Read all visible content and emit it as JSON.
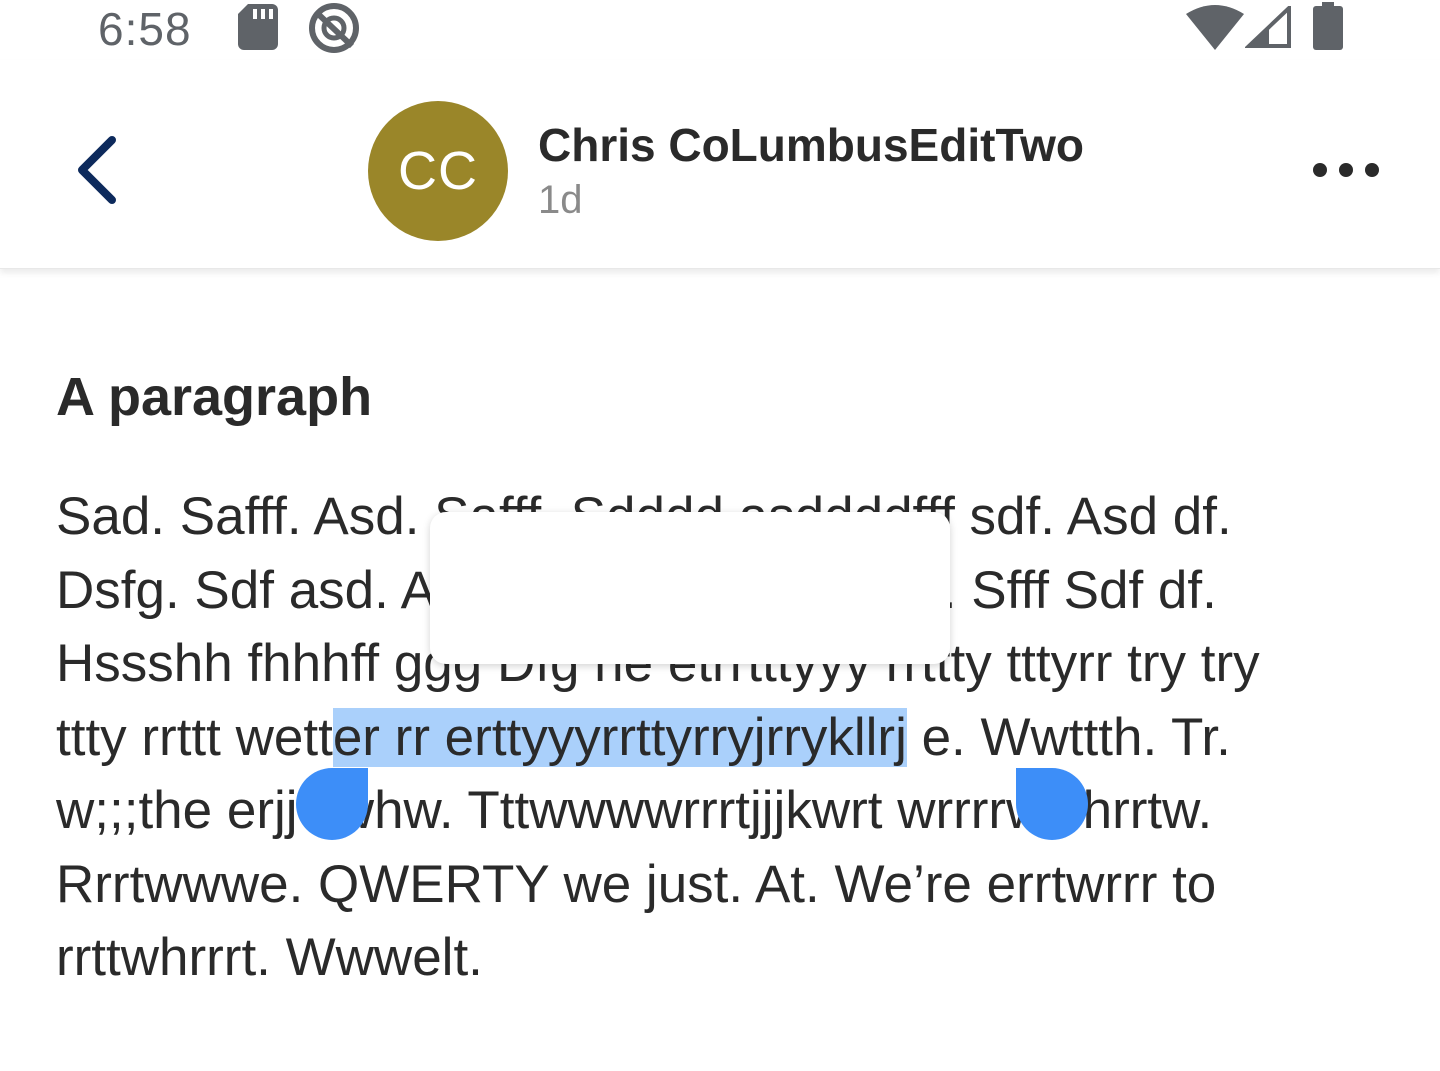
{
  "status_bar": {
    "time": "6:58",
    "icons": [
      "sd-card-icon",
      "do-not-disturb-icon",
      "wifi-icon",
      "signal-icon",
      "battery-icon"
    ]
  },
  "header": {
    "back_icon": "chevron-left-icon",
    "avatar_initials": "CC",
    "avatar_color": "#9a8629",
    "sender_name": "Chris CoLumbusEditTwo",
    "time_ago": "1d",
    "more_icon": "more-horizontal-icon"
  },
  "content": {
    "heading": "A paragraph",
    "lines": [
      {
        "pre": "Sad. Safff. Asd. Safff. Sdddd asddddfff sdf. Asd df.",
        "sel": "",
        "post": ""
      },
      {
        "pre": "Dsfg. Sdf asd. Asd. Sdf. Sdfff. Sfff sffff. Sfff Sdf df.",
        "sel": "",
        "post": ""
      },
      {
        "pre": "Hssshh fhhhff ggg Dfg he etrrtttyyy rrttty tttyrr try try",
        "sel": "",
        "post": ""
      },
      {
        "pre": "ttty rrttt wett",
        "sel": "er rr erttyyyrrttyrryjrrykllrj",
        "post": " e. Wwttth. Tr."
      },
      {
        "pre": "w;;;the erjjwwhw. Tttwwwwrrrtjjjkwrt wrrrrwwhrrtw.",
        "sel": "",
        "post": ""
      },
      {
        "pre": "Rrrtwwwe. QWERTY we just. At. We’re errtwrrr to",
        "sel": "",
        "post": ""
      },
      {
        "pre": "rrttwhrrrt. Wwwelt.",
        "sel": "",
        "post": ""
      }
    ]
  },
  "colors": {
    "selection": "#aad0fb",
    "handle": "#3d8ef8",
    "back_arrow": "#0d2a5c"
  }
}
